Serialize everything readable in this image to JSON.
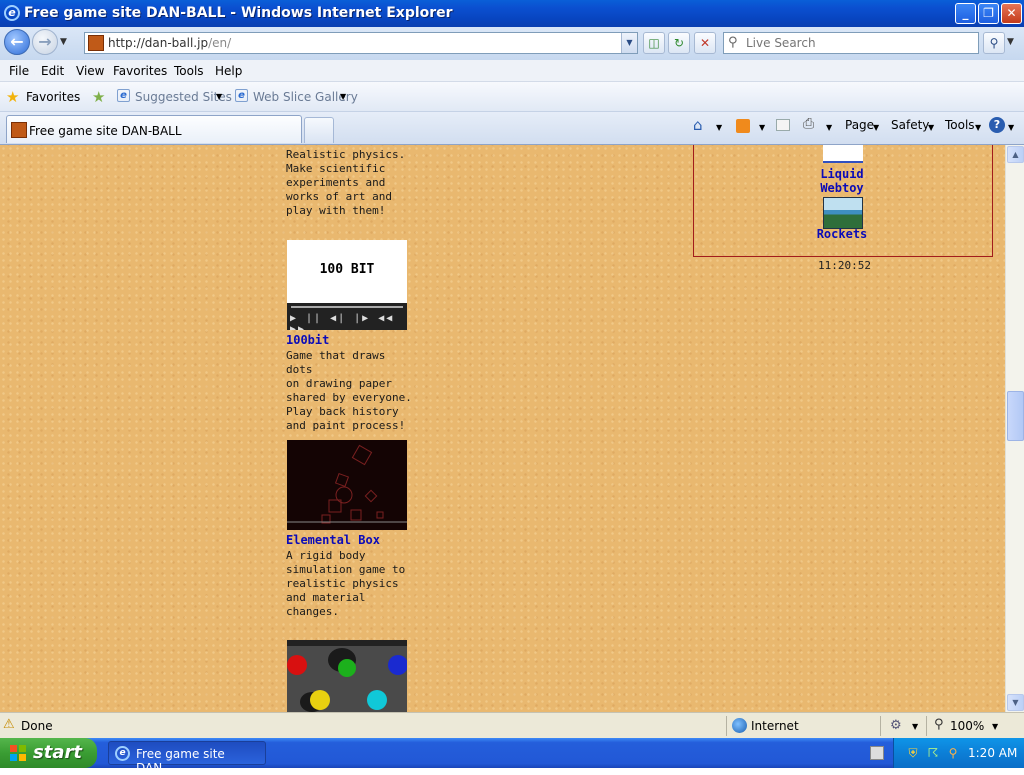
{
  "window": {
    "title": "Free game site DAN-BALL - Windows Internet Explorer",
    "minimize": "_",
    "maximize": "❐",
    "close": "✕"
  },
  "address_bar": {
    "url_host": "http://dan-ball.jp",
    "url_path": "/en/",
    "search_placeholder": "Live Search"
  },
  "menu": [
    "File",
    "Edit",
    "View",
    "Favorites",
    "Tools",
    "Help"
  ],
  "favorites_bar": {
    "favorites": "Favorites",
    "suggested": "Suggested Sites",
    "web_slice": "Web Slice Gallery"
  },
  "tab": {
    "label": "Free game site DAN-BALL"
  },
  "command_bar": {
    "page": "Page",
    "safety": "Safety",
    "tools": "Tools"
  },
  "content": {
    "top_desc": "Realistic physics.\nMake scientific\nexperiments and\nworks of art and\nplay with them!",
    "games": [
      {
        "name": "100bit",
        "thumb_text": "100 BIT",
        "desc": "Game that draws dots\non drawing paper\nshared by everyone.\nPlay back history\nand paint process!"
      },
      {
        "name": "Elemental Box",
        "desc": "A rigid body\nsimulation game to\nrealistic physics\nand material\nchanges."
      }
    ],
    "right_links": [
      {
        "label": "Liquid\nWebtoy"
      },
      {
        "label": "Rockets"
      }
    ],
    "clock": "11:20:52"
  },
  "status": {
    "text": "Done",
    "zone": "Internet",
    "zoom": "100%"
  },
  "taskbar": {
    "start": "start",
    "task_item": "Free game site DAN-...",
    "time": "1:20 AM"
  }
}
